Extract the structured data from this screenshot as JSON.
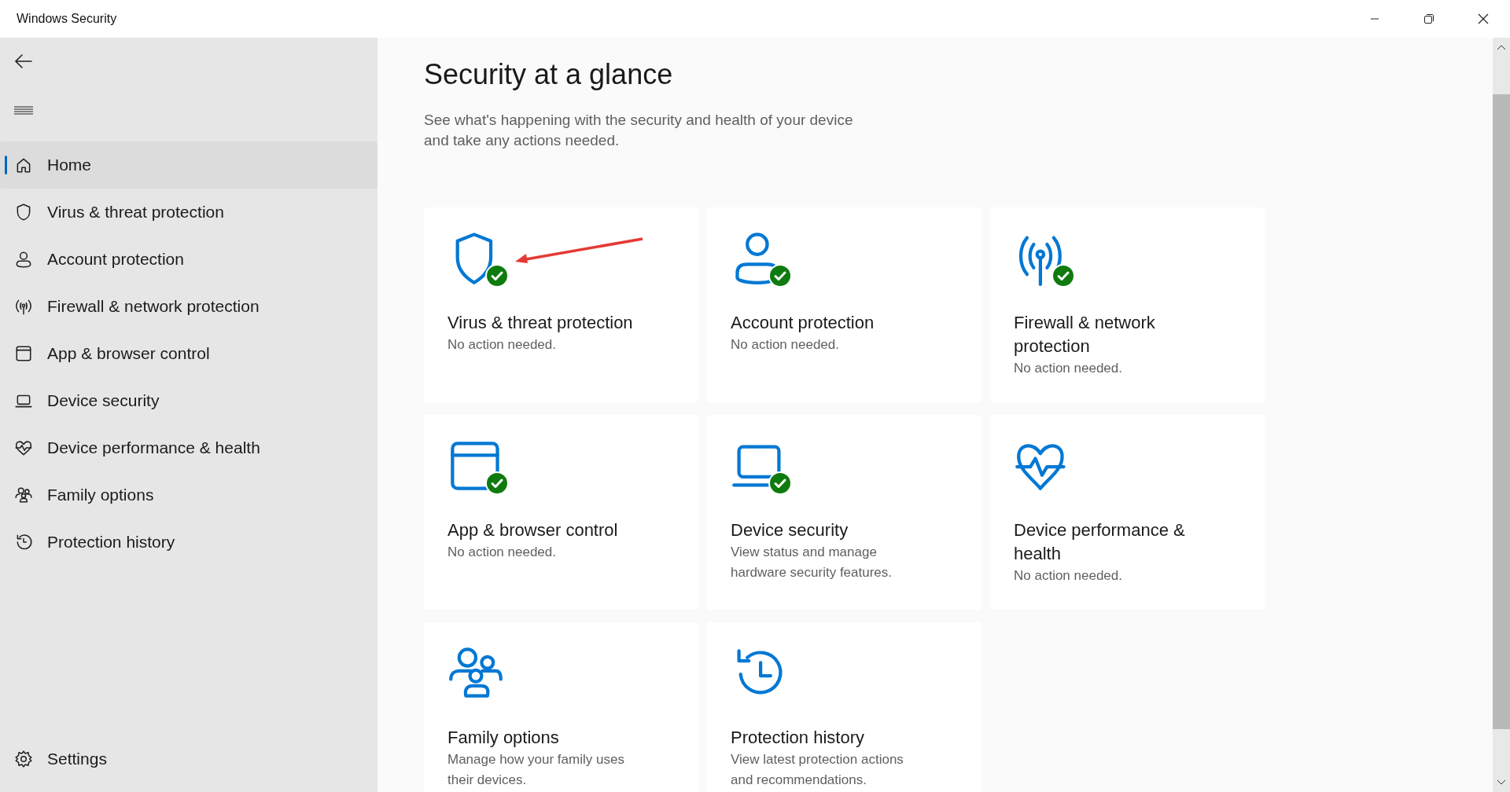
{
  "window": {
    "title": "Windows Security"
  },
  "sidebar": {
    "items": [
      {
        "label": "Home",
        "selected": true
      },
      {
        "label": "Virus & threat protection",
        "selected": false
      },
      {
        "label": "Account protection",
        "selected": false
      },
      {
        "label": "Firewall & network protection",
        "selected": false
      },
      {
        "label": "App & browser control",
        "selected": false
      },
      {
        "label": "Device security",
        "selected": false
      },
      {
        "label": "Device performance & health",
        "selected": false
      },
      {
        "label": "Family options",
        "selected": false
      },
      {
        "label": "Protection history",
        "selected": false
      }
    ],
    "settings": "Settings"
  },
  "page": {
    "title": "Security at a glance",
    "subtitle": "See what's happening with the security and health of your device\nand take any actions needed."
  },
  "cards": [
    {
      "title": "Virus & threat protection",
      "status": "No action needed.",
      "ok": true
    },
    {
      "title": "Account protection",
      "status": "No action needed.",
      "ok": true
    },
    {
      "title": "Firewall & network\nprotection",
      "status": "No action needed.",
      "ok": true
    },
    {
      "title": "App & browser control",
      "status": "No action needed.",
      "ok": true
    },
    {
      "title": "Device security",
      "status": "View status and manage\nhardware security features.",
      "ok": true
    },
    {
      "title": "Device performance &\nhealth",
      "status": "No action needed.",
      "ok": false
    },
    {
      "title": "Family options",
      "status": "Manage how your family uses\ntheir devices.",
      "ok": false
    },
    {
      "title": "Protection history",
      "status": "View latest protection actions\nand recommendations.",
      "ok": false
    }
  ]
}
